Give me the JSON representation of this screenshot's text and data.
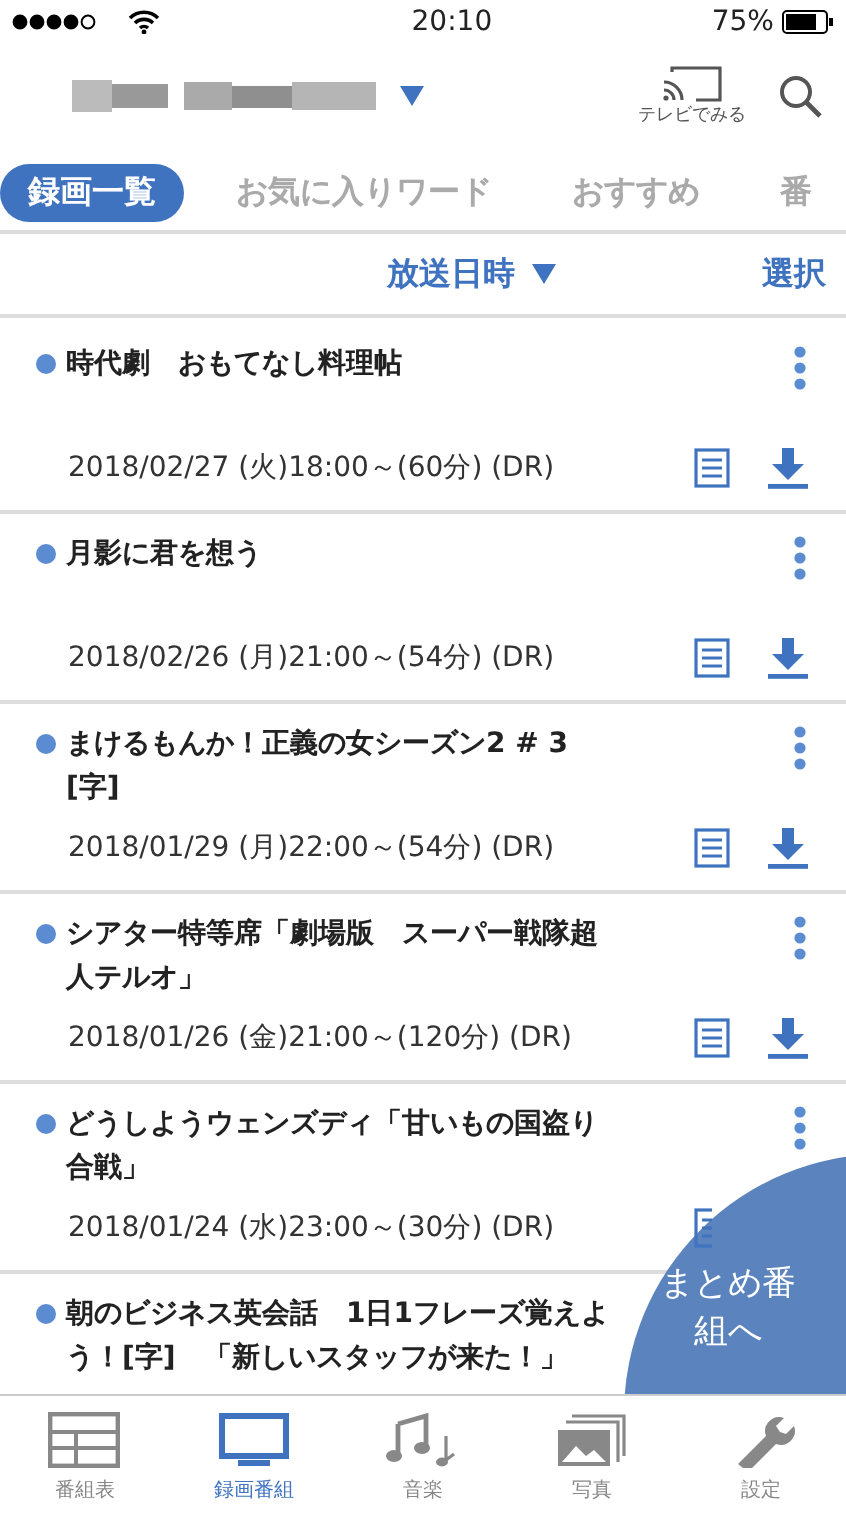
{
  "status_bar": {
    "time": "20:10",
    "battery": "75%"
  },
  "header": {
    "cast_label": "テレビでみる"
  },
  "tabs": [
    {
      "label": "録画一覧",
      "selected": true
    },
    {
      "label": "お気に入りワード",
      "selected": false
    },
    {
      "label": "おすすめ",
      "selected": false
    },
    {
      "label": "番",
      "selected": false
    }
  ],
  "sort": {
    "label": "放送日時",
    "action": "選択"
  },
  "recordings": [
    {
      "title": "時代劇　おもてなし料理帖",
      "date": "2018/02/27 (火)18:00～(60分) (DR)",
      "icons": [
        {
          "kind": "note"
        },
        {
          "kind": "download"
        }
      ]
    },
    {
      "title": "月影に君を想う",
      "date": "2018/02/26 (月)21:00～(54分) (DR)",
      "icons": [
        {
          "kind": "note"
        },
        {
          "kind": "download"
        }
      ]
    },
    {
      "title": "まけるもんか！正義の女シーズン2 # 3 [字]",
      "date": "2018/01/29 (月)22:00～(54分) (DR)",
      "icons": [
        {
          "kind": "note"
        },
        {
          "kind": "download"
        }
      ]
    },
    {
      "title": "シアター特等席「劇場版　スーパー戦隊超人テルオ」",
      "date": "2018/01/26 (金)21:00～(120分) (DR)",
      "icons": [
        {
          "kind": "note"
        },
        {
          "kind": "download"
        }
      ]
    },
    {
      "title": "どうしようウェンズディ「甘いもの国盗り合戦」",
      "date": "2018/01/24 (水)23:00～(30分) (DR)",
      "icons": [
        {
          "kind": "note_cut"
        }
      ]
    },
    {
      "title": "朝のビジネス英会話　1日1フレーズ覚えよう！[字]　「新しいスタッフが来た！」"
    }
  ],
  "fab": {
    "label": "まとめ番組へ"
  },
  "tab_bar": [
    {
      "label": "番組表",
      "kind": "grid",
      "selected": false
    },
    {
      "label": "録画番組",
      "kind": "tv",
      "selected": true
    },
    {
      "label": "音楽",
      "kind": "music",
      "selected": false
    },
    {
      "label": "写真",
      "kind": "photo",
      "selected": false
    },
    {
      "label": "設定",
      "kind": "wrench",
      "selected": false
    }
  ]
}
